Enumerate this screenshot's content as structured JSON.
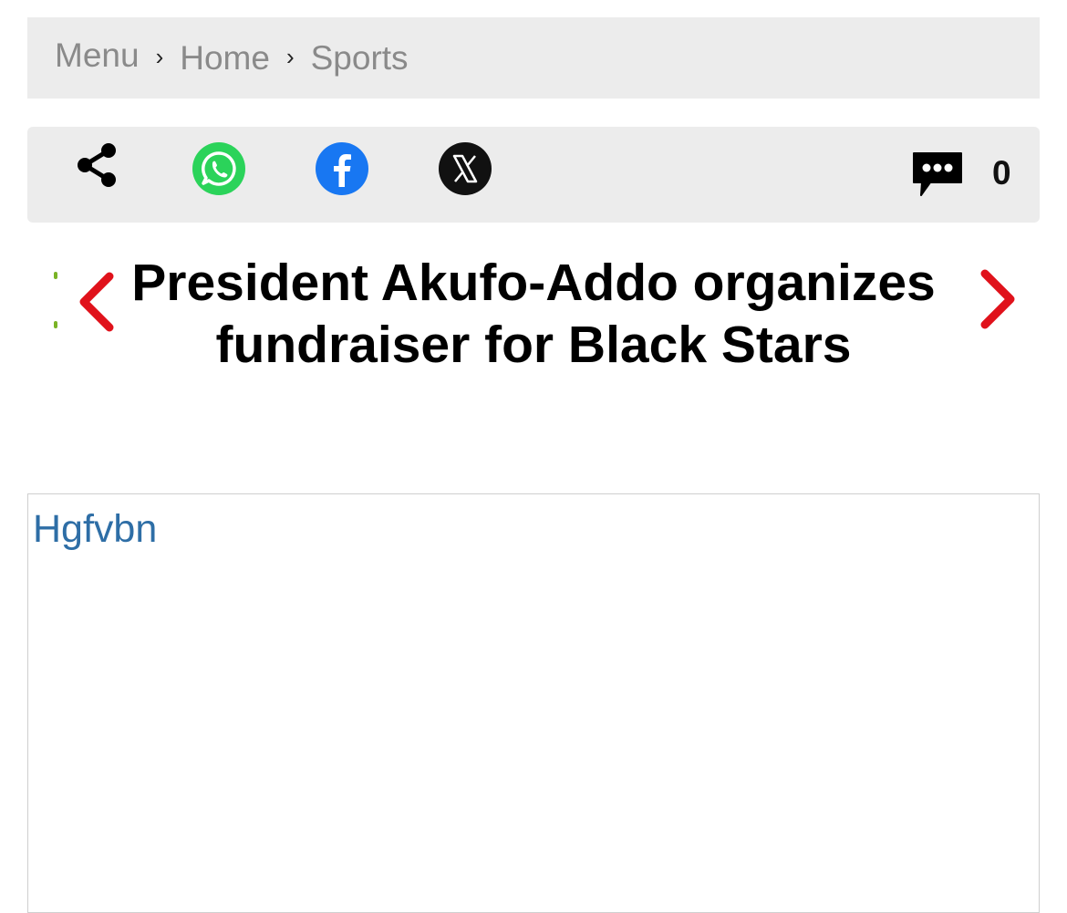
{
  "breadcrumb": {
    "items": [
      "Menu",
      "Home",
      "Sports"
    ],
    "separator": "›"
  },
  "share_bar": {
    "icons": [
      "share-icon",
      "whatsapp-icon",
      "facebook-icon",
      "x-icon",
      "comment-icon"
    ],
    "comment_count": "0",
    "colors": {
      "whatsapp": "#2bd35a",
      "facebook": "#1877f2",
      "x": "#111111"
    }
  },
  "article": {
    "title": "President Akufo-Addo organizes fundraiser for Black Stars",
    "nav_color": "#e0121b"
  },
  "content": {
    "link_text": "Hgfvbn",
    "link_color": "#2e6ea6"
  }
}
